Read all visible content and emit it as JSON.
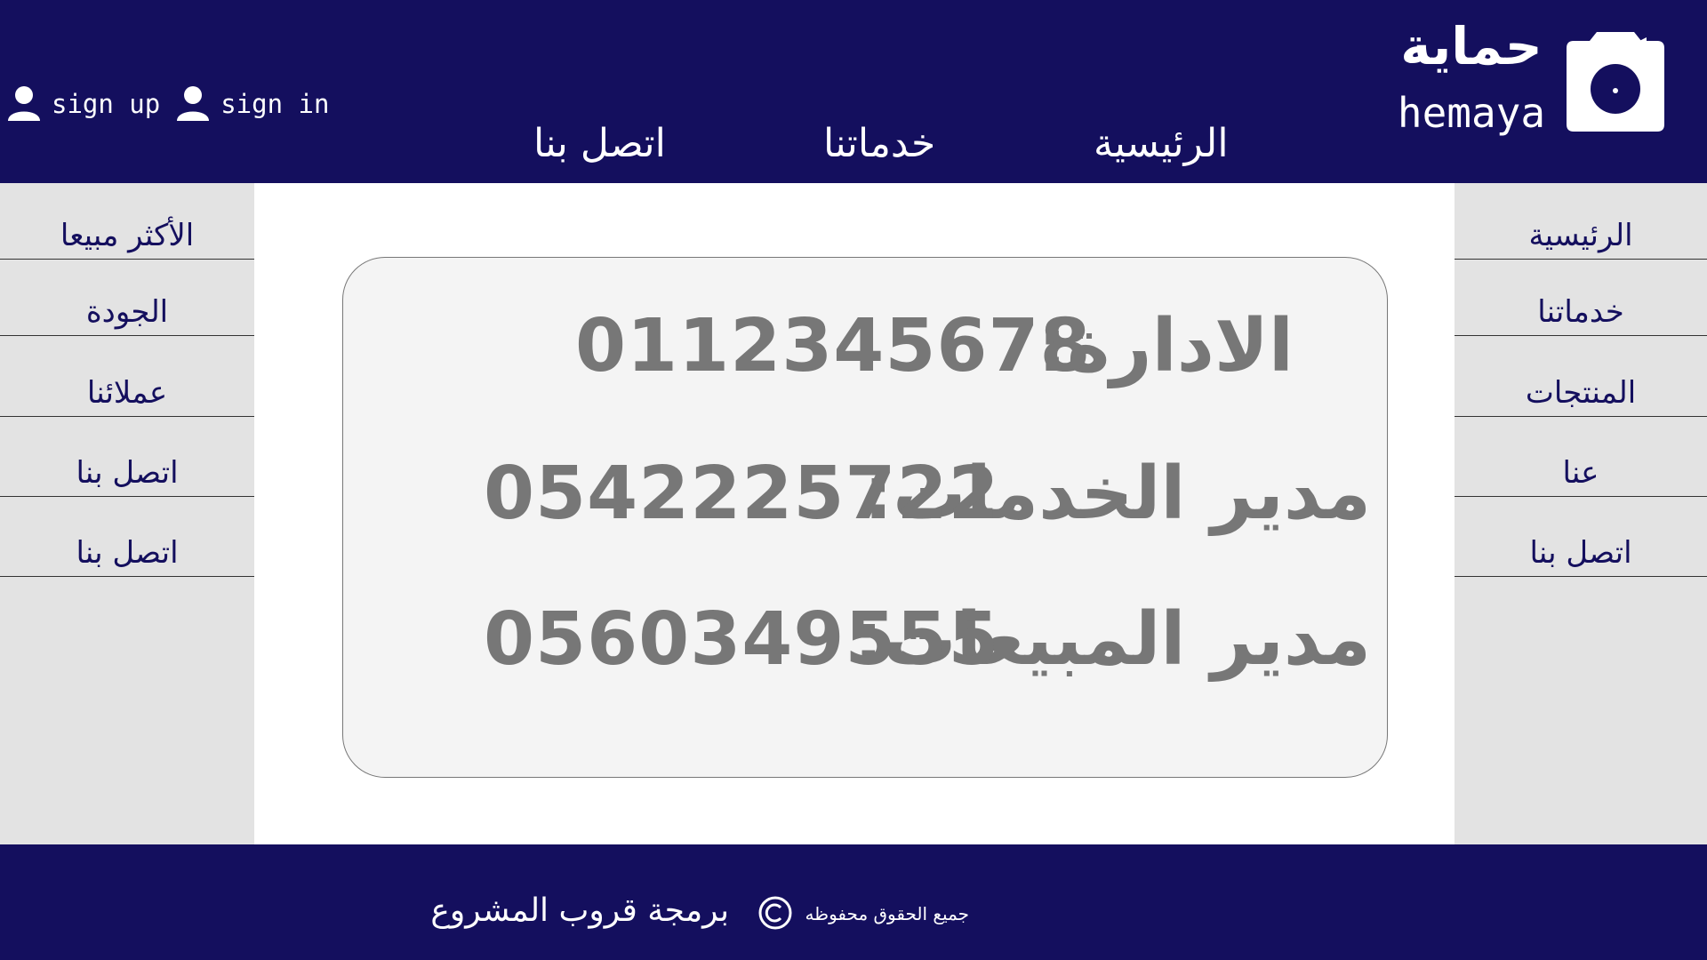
{
  "header": {
    "auth": {
      "sign_up": "sign up",
      "sign_in": "sign in"
    },
    "nav": {
      "contact": "اتصل بنا",
      "services": "خدماتنا",
      "home": "الرئيسية"
    },
    "logo": {
      "arabic": "حماية",
      "english": "hemaya",
      "icon": "camera-icon"
    },
    "color": "#140f5e"
  },
  "left_sidebar": {
    "items": [
      {
        "label": "الأكثر مبيعا"
      },
      {
        "label": "الجودة"
      },
      {
        "label": "عملائنا"
      },
      {
        "label": "اتصل بنا"
      },
      {
        "label": "اتصل بنا"
      }
    ]
  },
  "right_sidebar": {
    "items": [
      {
        "label": "الرئيسية"
      },
      {
        "label": "خدماتنا"
      },
      {
        "label": "المنتجات"
      },
      {
        "label": "عنا"
      },
      {
        "label": "اتصل بنا"
      }
    ]
  },
  "contacts": {
    "management": {
      "label": "الادارة:",
      "number": "0112345678"
    },
    "services_manager": {
      "label": "مدير الخدمات:",
      "number": "0542225722"
    },
    "sales_manager": {
      "label": "مدير المبيعات:",
      "number": "0560349555"
    }
  },
  "footer": {
    "credit": "برمجة قروب المشروع",
    "rights": "جميع الحقوق محفوظه",
    "copyright_icon": "copyright-icon"
  }
}
